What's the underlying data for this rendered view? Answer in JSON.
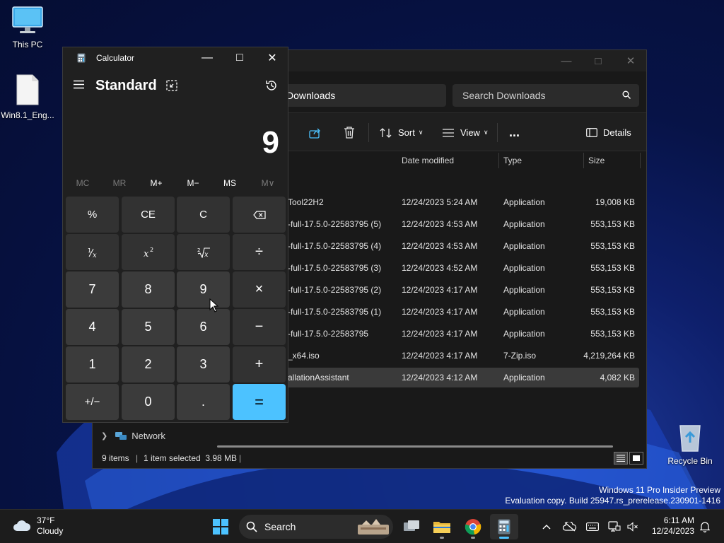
{
  "desktop": {
    "this_pc_label": "This PC",
    "file_label": "Win8.1_Eng...",
    "recycle_label": "Recycle Bin",
    "watermark_line1": "Windows 11 Pro Insider Preview",
    "watermark_line2": "Evaluation copy. Build 25947.rs_prerelease.230901-1416"
  },
  "explorer": {
    "address": "Downloads",
    "search_placeholder": "Search Downloads",
    "toolbar": {
      "sort": "Sort",
      "view": "View",
      "more": "...",
      "details": "Details"
    },
    "columns": [
      "Date modified",
      "Type",
      "Size"
    ],
    "rows": [
      {
        "name": "Tool22H2",
        "date": "12/24/2023 5:24 AM",
        "type": "Application",
        "size": "19,008 KB"
      },
      {
        "name": "-full-17.5.0-22583795 (5)",
        "date": "12/24/2023 4:53 AM",
        "type": "Application",
        "size": "553,153 KB"
      },
      {
        "name": "-full-17.5.0-22583795 (4)",
        "date": "12/24/2023 4:53 AM",
        "type": "Application",
        "size": "553,153 KB"
      },
      {
        "name": "-full-17.5.0-22583795 (3)",
        "date": "12/24/2023 4:52 AM",
        "type": "Application",
        "size": "553,153 KB"
      },
      {
        "name": "-full-17.5.0-22583795 (2)",
        "date": "12/24/2023 4:17 AM",
        "type": "Application",
        "size": "553,153 KB"
      },
      {
        "name": "-full-17.5.0-22583795 (1)",
        "date": "12/24/2023 4:17 AM",
        "type": "Application",
        "size": "553,153 KB"
      },
      {
        "name": "-full-17.5.0-22583795",
        "date": "12/24/2023 4:17 AM",
        "type": "Application",
        "size": "553,153 KB"
      },
      {
        "name": "_x64.iso",
        "date": "12/24/2023 4:17 AM",
        "type": "7-Zip.iso",
        "size": "4,219,264 KB"
      },
      {
        "name": "allationAssistant",
        "date": "12/24/2023 4:12 AM",
        "type": "Application",
        "size": "4,082 KB"
      }
    ],
    "nav_network": "Network",
    "status": {
      "count": "9 items",
      "selected": "1 item selected  3.98 MB"
    }
  },
  "calculator": {
    "title": "Calculator",
    "mode": "Standard",
    "display": "9",
    "memory": [
      "MC",
      "MR",
      "M+",
      "M−",
      "MS",
      "M∨"
    ],
    "keys": {
      "percent": "%",
      "ce": "CE",
      "c": "C",
      "divide": "÷",
      "seven": "7",
      "eight": "8",
      "nine": "9",
      "multiply": "×",
      "four": "4",
      "five": "5",
      "six": "6",
      "minus": "−",
      "one": "1",
      "two": "2",
      "three": "3",
      "plus": "+",
      "negate": "+/−",
      "zero": "0",
      "decimal": ".",
      "equals": "="
    }
  },
  "taskbar": {
    "temperature": "37°F",
    "condition": "Cloudy",
    "search": "Search",
    "time": "6:11 AM",
    "date": "12/24/2023"
  },
  "colors": {
    "accent": "#4cc2ff",
    "selection": "#3a3a3a"
  }
}
